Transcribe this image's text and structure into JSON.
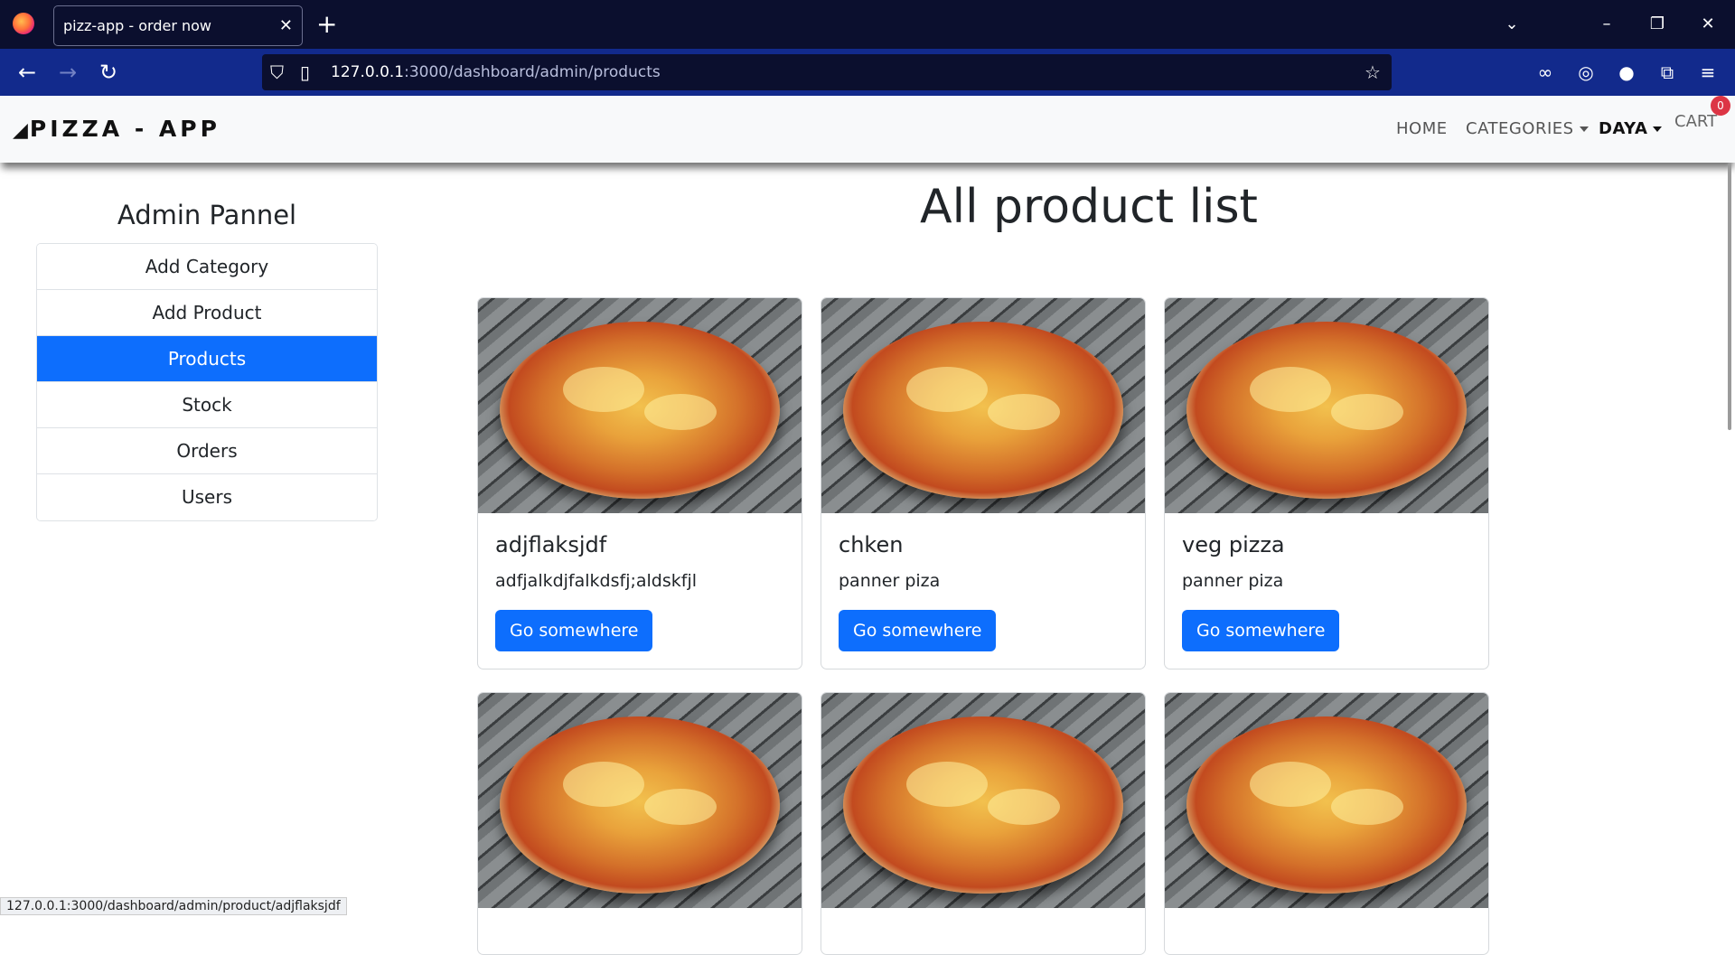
{
  "browser": {
    "tab_title": "pizz-app - order now",
    "tab_close": "✕",
    "new_tab": "+",
    "url_host": "127.0.0.1",
    "url_path": ":3000/dashboard/admin/products",
    "status_url": "127.0.0.1:3000/dashboard/admin/product/adjflaksjdf"
  },
  "app": {
    "brand": "PIZZA - APP",
    "nav": {
      "home": "HOME",
      "categories": "CATEGORIES",
      "user": "DAYA",
      "cart": "CART",
      "cart_count": "0"
    }
  },
  "sidebar": {
    "title": "Admin Pannel",
    "items": [
      {
        "label": "Add Category"
      },
      {
        "label": "Add Product"
      },
      {
        "label": "Products"
      },
      {
        "label": "Stock"
      },
      {
        "label": "Orders"
      },
      {
        "label": "Users"
      }
    ],
    "active_index": 2
  },
  "main": {
    "title": "All product list",
    "cards": [
      {
        "title": "adjflaksjdf",
        "text": "adfjalkdjfalkdsfj;aldskfjl",
        "button": "Go somewhere"
      },
      {
        "title": "chken",
        "text": "panner piza",
        "button": "Go somewhere"
      },
      {
        "title": "veg pizza",
        "text": "panner piza",
        "button": "Go somewhere"
      },
      {
        "title": "",
        "text": "",
        "button": ""
      },
      {
        "title": "",
        "text": "",
        "button": ""
      },
      {
        "title": "",
        "text": "",
        "button": ""
      }
    ]
  },
  "colors": {
    "primary": "#0d6efd",
    "badge": "#dc3545",
    "chrome_dark": "#0b0f2e",
    "chrome_blue": "#122a8c"
  }
}
